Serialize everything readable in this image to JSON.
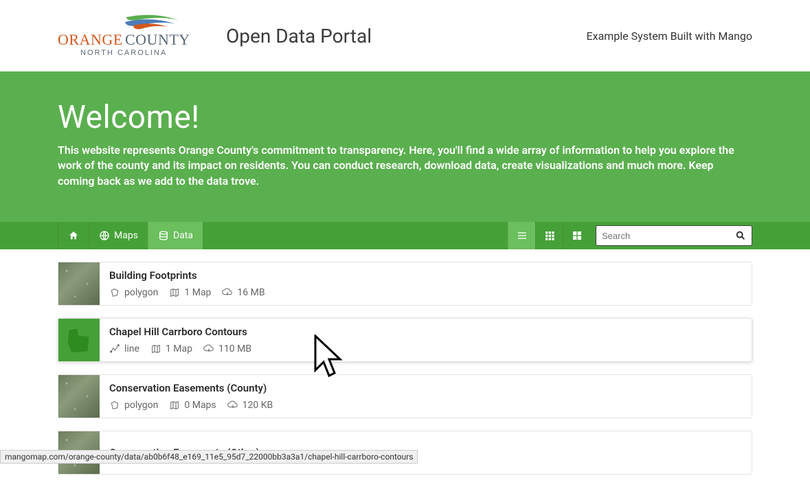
{
  "header": {
    "org_top": "ORANGE COUNTY",
    "org_sub": "NORTH CAROLINA",
    "portal_title": "Open Data Portal",
    "tagline": "Example System Built with Mango"
  },
  "hero": {
    "title": "Welcome!",
    "body": "This website represents Orange County's commitment to transparency. Here, you'll find a wide array of information to help you explore the work of the county and its impact on residents. You can conduct research, download data, create visualizations and much more. Keep coming back as we add to the data trove."
  },
  "nav": {
    "maps_label": "Maps",
    "data_label": "Data",
    "search_placeholder": "Search"
  },
  "datasets": [
    {
      "title": "Building Footprints",
      "geom": "polygon",
      "maps": "1 Map",
      "size": "16 MB"
    },
    {
      "title": "Chapel Hill Carrboro Contours",
      "geom": "line",
      "maps": "1 Map",
      "size": "110 MB"
    },
    {
      "title": "Conservation Easements (County)",
      "geom": "polygon",
      "maps": "0 Maps",
      "size": "120 KB"
    },
    {
      "title": "Conservation Easements (Other)",
      "geom": "",
      "maps": "",
      "size": ""
    }
  ],
  "status_url": "mangomap.com/orange-county/data/ab0b6f48_e169_11e5_95d7_22000bb3a3a1/chapel-hill-carrboro-contours"
}
